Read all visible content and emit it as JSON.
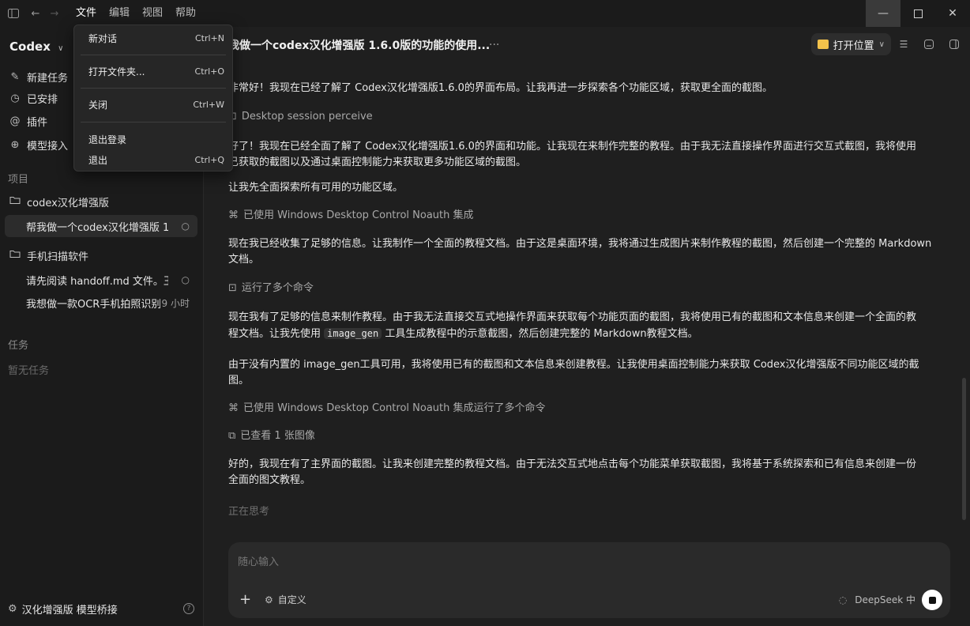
{
  "titlebar": {
    "menus": [
      "文件",
      "编辑",
      "视图",
      "帮助"
    ],
    "active_menu": "文件"
  },
  "file_menu": {
    "items": [
      {
        "label": "新对话",
        "shortcut": "Ctrl+N"
      },
      {
        "label": "打开文件夹...",
        "shortcut": "Ctrl+O"
      },
      {
        "label": "关闭",
        "shortcut": "Ctrl+W"
      },
      {
        "label": "退出登录",
        "shortcut": ""
      },
      {
        "label": "退出",
        "shortcut": "Ctrl+Q"
      }
    ]
  },
  "sidebar": {
    "app_name": "Codex",
    "nav": [
      {
        "label": "新建任务",
        "icon": "edit-icon"
      },
      {
        "label": "已安排",
        "icon": "clock-icon"
      },
      {
        "label": "插件",
        "icon": "at-icon"
      },
      {
        "label": "模型接入",
        "icon": "plus-circle-icon"
      }
    ],
    "projects_label": "项目",
    "projects": [
      {
        "name": "codex汉化增强版",
        "threads": [
          {
            "title": "帮我做一个codex汉化增强版 1",
            "meta": "○",
            "selected": true
          }
        ]
      },
      {
        "name": "手机扫描软件",
        "threads": [
          {
            "title": "请先阅读 handoff.md 文件。王",
            "meta": "○",
            "selected": false
          },
          {
            "title": "我想做一款OCR手机拍照识别",
            "meta": "9 小时",
            "selected": false
          }
        ]
      }
    ],
    "tasks_label": "任务",
    "tasks_empty": "暂无任务",
    "footer_label": "汉化增强版 模型桥接",
    "footer_help": "?"
  },
  "header": {
    "title": "帮我做一个codex汉化增强版 1.6.0版的功能的使用...",
    "more": "···",
    "open_location": "打开位置"
  },
  "messages": {
    "p1": "非常好！我现在已经了解了 Codex汉化增强版1.6.0的界面布局。让我再进一步探索各个功能区域，获取更全面的截图。",
    "tool1": "Desktop session perceive",
    "p2a": "好了！我现在已经全面了解了 Codex汉化增强版1.6.0的界面和功能。让我现在来制作完整的教程。由于我无法直接操作界面进行交互式截图，我将使用",
    "p2b": "已获取的截图以及通过桌面控制能力来获取更多功能区域的截图。",
    "p3": "让我先全面探索所有可用的功能区域。",
    "tool2": "已使用 Windows Desktop Control Noauth 集成",
    "p4a": "现在我已经收集了足够的信息。让我制作一个全面的教程文档。由于这是桌面环境，我将通过生成图片来制作教程的截图，然后创建一个完整的 Markdown",
    "p4b": "文档。",
    "tool3": "运行了多个命令",
    "p5a": "现在我有了足够的信息来制作教程。由于我无法直接交互式地操作界面来获取每个功能页面的截图，我将使用已有的截图和文本信息来创建一个全面的教",
    "p5b_pre": "程文档。让我先使用",
    "p5b_code": "image_gen",
    "p5b_post": "工具生成教程中的示意截图，然后创建完整的 Markdown教程文档。",
    "p6a": "由于没有内置的 image_gen工具可用，我将使用已有的截图和文本信息来创建教程。让我使用桌面控制能力来获取 Codex汉化增强版不同功能区域的截",
    "p6b": "图。",
    "tool4": "已使用 Windows Desktop Control Noauth 集成运行了多个命令",
    "tool5": "已查看 1 张图像",
    "p7a": "好的，我现在有了主界面的截图。让我来创建完整的教程文档。由于无法交互式地点击每个功能菜单获取截图，我将基于系统探索和已有信息来创建一份",
    "p7b": "全面的图文教程。",
    "thinking": "正在思考"
  },
  "composer": {
    "placeholder": "随心输入",
    "plus": "+",
    "custom_label": "自定义",
    "model_label": "DeepSeek 中"
  },
  "colors": {
    "background": "#1f1f1f",
    "sidebar": "#1b1b1b",
    "folder_icon": "#f3c24b"
  }
}
